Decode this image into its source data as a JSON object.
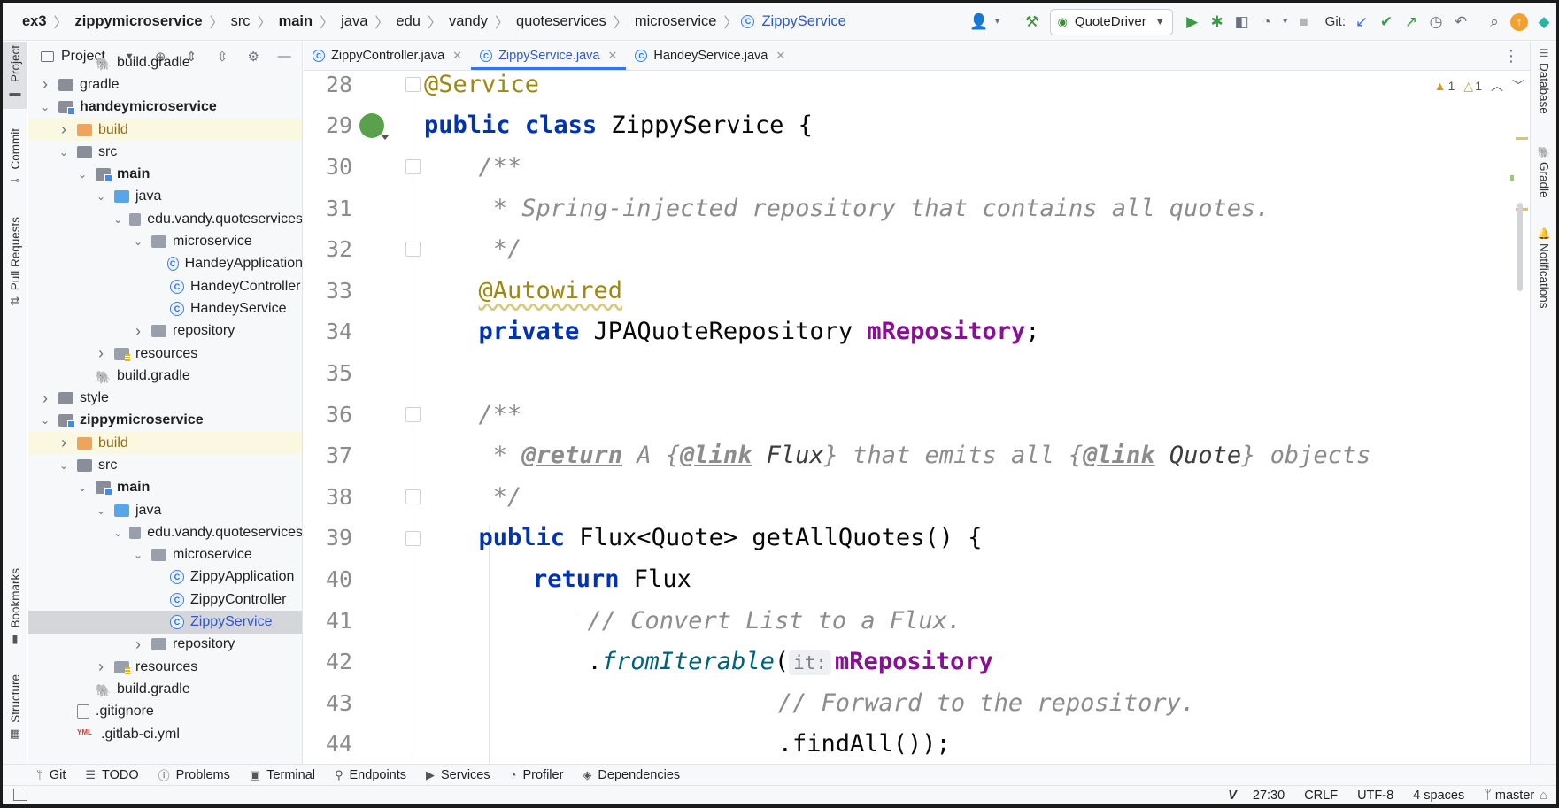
{
  "breadcrumbs": [
    {
      "label": "ex3",
      "bold": true
    },
    {
      "label": "zippymicroservice",
      "bold": true
    },
    {
      "label": "src",
      "bold": false
    },
    {
      "label": "main",
      "bold": true
    },
    {
      "label": "java",
      "bold": false
    },
    {
      "label": "edu",
      "bold": false
    },
    {
      "label": "vandy",
      "bold": false
    },
    {
      "label": "quoteservices",
      "bold": false
    },
    {
      "label": "microservice",
      "bold": false
    },
    {
      "label": "ZippyService",
      "bold": false,
      "is_class": true
    }
  ],
  "toolbar": {
    "run_config": "QuoteDriver",
    "git_label": "Git:"
  },
  "left_strip": {
    "tabs": [
      "Project",
      "Commit",
      "Pull Requests",
      "Bookmarks",
      "Structure"
    ]
  },
  "right_strip": {
    "tabs": [
      "Database",
      "Gradle",
      "Notifications"
    ]
  },
  "project_panel": {
    "title": "Project",
    "tree": [
      {
        "label": "build.gradle",
        "indent": 3,
        "type": "gradle",
        "chev": "none",
        "partial": true
      },
      {
        "label": "gradle",
        "indent": 1,
        "type": "folder",
        "chev": "closed"
      },
      {
        "label": "handeymicroservice",
        "indent": 1,
        "type": "module",
        "chev": "open",
        "bold": true
      },
      {
        "label": "build",
        "indent": 2,
        "type": "folder-orange",
        "chev": "closed",
        "highlight": true
      },
      {
        "label": "src",
        "indent": 2,
        "type": "folder",
        "chev": "open"
      },
      {
        "label": "main",
        "indent": 3,
        "type": "module",
        "chev": "open",
        "bold": true
      },
      {
        "label": "java",
        "indent": 4,
        "type": "folder-blue",
        "chev": "open"
      },
      {
        "label": "edu.vandy.quoteservices",
        "indent": 5,
        "type": "pkg",
        "chev": "open"
      },
      {
        "label": "microservice",
        "indent": 6,
        "type": "pkg",
        "chev": "open"
      },
      {
        "label": "HandeyApplication",
        "indent": 7,
        "type": "class-app",
        "chev": "none"
      },
      {
        "label": "HandeyController",
        "indent": 7,
        "type": "class",
        "chev": "none"
      },
      {
        "label": "HandeyService",
        "indent": 7,
        "type": "class",
        "chev": "none"
      },
      {
        "label": "repository",
        "indent": 6,
        "type": "pkg",
        "chev": "closed"
      },
      {
        "label": "resources",
        "indent": 4,
        "type": "folder-res",
        "chev": "closed"
      },
      {
        "label": "build.gradle",
        "indent": 3,
        "type": "gradle",
        "chev": "none"
      },
      {
        "label": "style",
        "indent": 1,
        "type": "folder",
        "chev": "closed"
      },
      {
        "label": "zippymicroservice",
        "indent": 1,
        "type": "module",
        "chev": "open",
        "bold": true
      },
      {
        "label": "build",
        "indent": 2,
        "type": "folder-orange",
        "chev": "closed",
        "highlight": true
      },
      {
        "label": "src",
        "indent": 2,
        "type": "folder",
        "chev": "open"
      },
      {
        "label": "main",
        "indent": 3,
        "type": "module",
        "chev": "open",
        "bold": true
      },
      {
        "label": "java",
        "indent": 4,
        "type": "folder-blue",
        "chev": "open"
      },
      {
        "label": "edu.vandy.quoteservices",
        "indent": 5,
        "type": "pkg",
        "chev": "open"
      },
      {
        "label": "microservice",
        "indent": 6,
        "type": "pkg",
        "chev": "open"
      },
      {
        "label": "ZippyApplication",
        "indent": 7,
        "type": "class-app",
        "chev": "none"
      },
      {
        "label": "ZippyController",
        "indent": 7,
        "type": "class",
        "chev": "none"
      },
      {
        "label": "ZippyService",
        "indent": 7,
        "type": "class",
        "chev": "none",
        "selected": true
      },
      {
        "label": "repository",
        "indent": 6,
        "type": "pkg",
        "chev": "closed"
      },
      {
        "label": "resources",
        "indent": 4,
        "type": "folder-res",
        "chev": "closed"
      },
      {
        "label": "build.gradle",
        "indent": 3,
        "type": "gradle",
        "chev": "none"
      },
      {
        "label": ".gitignore",
        "indent": 2,
        "type": "gitignore",
        "chev": "none"
      },
      {
        "label": ".gitlab-ci.yml",
        "indent": 2,
        "type": "yml",
        "chev": "none"
      }
    ]
  },
  "editor_tabs": [
    {
      "label": "ZippyController.java",
      "active": false
    },
    {
      "label": "ZippyService.java",
      "active": true
    },
    {
      "label": "HandeyService.java",
      "active": false
    }
  ],
  "inspections": {
    "warnings": "1",
    "weak_warnings": "1"
  },
  "code_lines": [
    {
      "n": "28",
      "indent": 0,
      "tokens": [
        [
          "ann",
          "@Service"
        ]
      ],
      "fold": true
    },
    {
      "n": "29",
      "indent": 0,
      "tokens": [
        [
          "kw",
          "public"
        ],
        [
          "t",
          " "
        ],
        [
          "kw",
          "class"
        ],
        [
          "t",
          " ZippyService {"
        ]
      ],
      "bean": true
    },
    {
      "n": "30",
      "indent": 1,
      "tokens": [
        [
          "cmt",
          "/**"
        ]
      ],
      "fold": true
    },
    {
      "n": "31",
      "indent": 1,
      "tokens": [
        [
          "cmt",
          " * Spring-injected repository that contains all quotes."
        ]
      ]
    },
    {
      "n": "32",
      "indent": 1,
      "tokens": [
        [
          "cmt",
          " */"
        ]
      ],
      "fold": true
    },
    {
      "n": "33",
      "indent": 1,
      "tokens": [
        [
          "annw",
          "@Autowired"
        ]
      ]
    },
    {
      "n": "34",
      "indent": 1,
      "tokens": [
        [
          "kw",
          "private"
        ],
        [
          "t",
          " JPAQuoteRepository "
        ],
        [
          "field",
          "mRepository"
        ],
        [
          "t",
          ";"
        ]
      ]
    },
    {
      "n": "35",
      "indent": 1,
      "tokens": []
    },
    {
      "n": "36",
      "indent": 1,
      "tokens": [
        [
          "cmt",
          "/**"
        ]
      ],
      "fold": true
    },
    {
      "n": "37",
      "indent": 1,
      "tokens": [
        [
          "cmt",
          " * "
        ],
        [
          "tag",
          "@return"
        ],
        [
          "cmt",
          " A {"
        ],
        [
          "tag",
          "@link"
        ],
        [
          "ref",
          " Flux"
        ],
        [
          "cmt",
          "} that emits all {"
        ],
        [
          "tag",
          "@link"
        ],
        [
          "ref",
          " Quote"
        ],
        [
          "cmt",
          "} objects"
        ]
      ]
    },
    {
      "n": "38",
      "indent": 1,
      "tokens": [
        [
          "cmt",
          " */"
        ]
      ],
      "fold": true
    },
    {
      "n": "39",
      "indent": 1,
      "tokens": [
        [
          "kw",
          "public"
        ],
        [
          "t",
          " Flux<Quote> getAllQuotes() {"
        ]
      ],
      "fold": true
    },
    {
      "n": "40",
      "indent": 2,
      "tokens": [
        [
          "kw",
          "return"
        ],
        [
          "t",
          " Flux"
        ]
      ]
    },
    {
      "n": "41",
      "indent": 3,
      "tokens": [
        [
          "cmt",
          "// Convert List to a Flux."
        ]
      ]
    },
    {
      "n": "42",
      "indent": 3,
      "tokens": [
        [
          "t",
          "."
        ],
        [
          "method",
          "fromIterable"
        ],
        [
          "t",
          "("
        ],
        [
          "hint",
          "it:"
        ],
        [
          "field",
          "mRepository"
        ]
      ]
    },
    {
      "n": "43",
      "indent": 6.5,
      "tokens": [
        [
          "cmt",
          "// Forward to the repository."
        ]
      ]
    },
    {
      "n": "44",
      "indent": 6.5,
      "tokens": [
        [
          "t",
          ".findAll());"
        ]
      ]
    }
  ],
  "bottom_tools": [
    {
      "label": "Git",
      "icon": "branch-icon",
      "glyph": "ᛘ"
    },
    {
      "label": "TODO",
      "icon": "list-icon",
      "glyph": "☰"
    },
    {
      "label": "Problems",
      "icon": "problems-icon",
      "glyph": "ⓘ"
    },
    {
      "label": "Terminal",
      "icon": "terminal-icon",
      "glyph": "▣"
    },
    {
      "label": "Endpoints",
      "icon": "endpoints-icon",
      "glyph": "⚲"
    },
    {
      "label": "Services",
      "icon": "services-icon",
      "glyph": "▶"
    },
    {
      "label": "Profiler",
      "icon": "profiler-icon",
      "glyph": "◔"
    },
    {
      "label": "Dependencies",
      "icon": "dependencies-icon",
      "glyph": "◈"
    }
  ],
  "status_bar": {
    "vim_mode": "V",
    "position": "27:30",
    "line_sep": "CRLF",
    "encoding": "UTF-8",
    "indent": "4 spaces",
    "branch": "master"
  }
}
